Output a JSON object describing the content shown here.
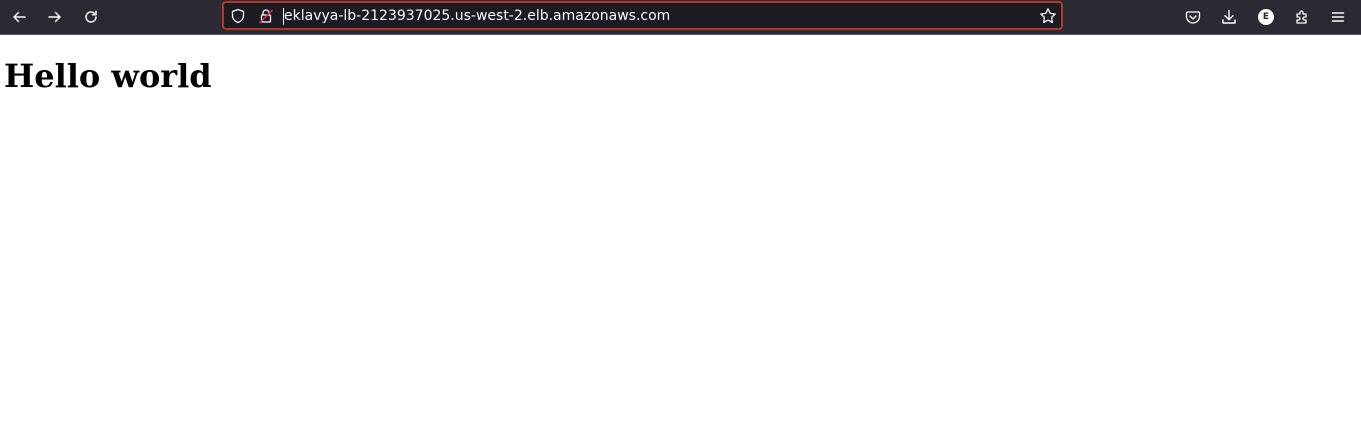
{
  "browser": {
    "navigation": {
      "back_icon": "arrow-left-icon",
      "forward_icon": "arrow-right-icon",
      "reload_icon": "reload-icon"
    },
    "url_bar": {
      "url": "eklavya-lb-2123937025.us-west-2.elb.amazonaws.com",
      "tracking_protection_icon": "shield-icon",
      "connection_icon": "insecure-lock-icon",
      "bookmark_icon": "star-icon"
    },
    "toolbar_right": {
      "pocket_icon": "pocket-icon",
      "downloads_icon": "download-icon",
      "account_initial": "E",
      "extensions_icon": "puzzle-icon",
      "menu_icon": "hamburger-menu-icon"
    },
    "colors": {
      "toolbar_bg": "#2b2a33",
      "urlbar_bg": "#1c1b22",
      "urlbar_focus_border": "#ab3a2a",
      "icon_color": "#fbfbfe",
      "insecure_accent": "#e22850"
    }
  },
  "page": {
    "heading": "Hello world"
  }
}
